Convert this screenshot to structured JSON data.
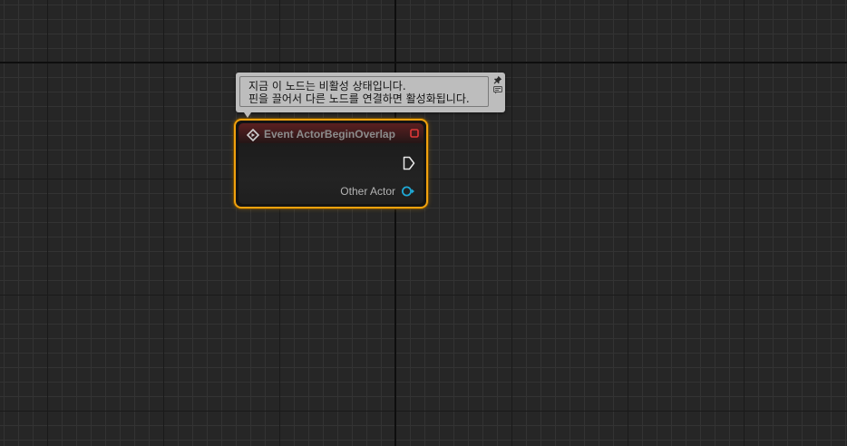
{
  "comment": {
    "lines": [
      "지금 이 노드는 비활성 상태입니다.",
      "핀을 끌어서 다른 노드를 연결하면 활성화됩니다."
    ]
  },
  "node": {
    "title": "Event ActorBeginOverlap",
    "output_pin_label": "Other Actor"
  },
  "colors": {
    "selection_outline": "#f1a10e",
    "header_event": "#5a1f20",
    "delegate_pin": "#e03838",
    "object_pin": "#1fa9d6"
  }
}
